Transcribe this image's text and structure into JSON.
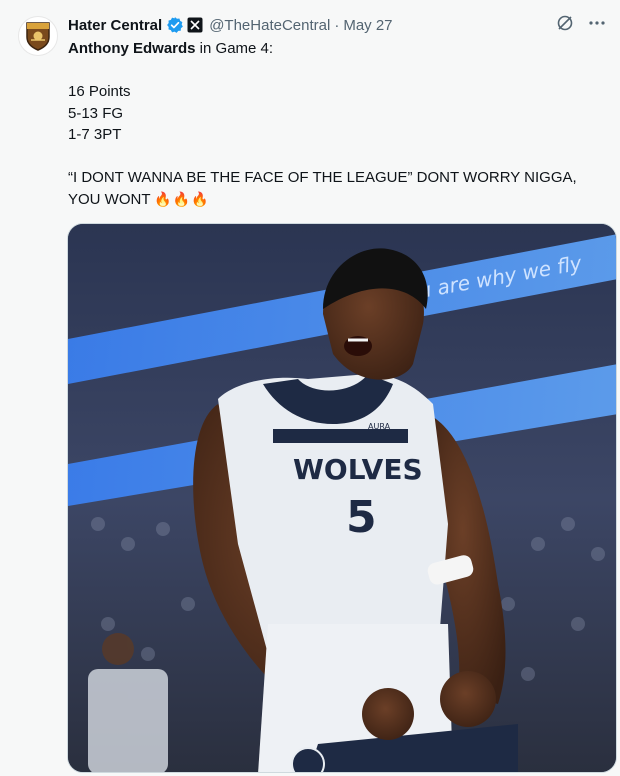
{
  "tweet": {
    "display_name": "Hater Central",
    "handle": "@TheHateCentral",
    "separator": "·",
    "date": "May 27",
    "icons": {
      "verified": "verified-badge-icon",
      "affiliate": "x-affiliate-icon",
      "grok": "grok-icon",
      "more": "more-options-icon"
    },
    "text": {
      "player_name": "Anthony Edwards",
      "line1_rest": " in Game 4:",
      "stat1": "16 Points",
      "stat2": "5-13 FG",
      "stat3": "1-7 3PT",
      "quote_line1": "“I DONT WANNA BE THE FACE OF THE LEAGUE” DONT WORRY NIGGA,",
      "quote_line2": "YOU WONT",
      "emoji": "🔥🔥🔥"
    },
    "media": {
      "jersey_team": "WOLVES",
      "jersey_number": "5",
      "jersey_sponsor": "AURA",
      "ad_banner": "You are why we fly",
      "accent_color": "#1d9bf0"
    }
  }
}
